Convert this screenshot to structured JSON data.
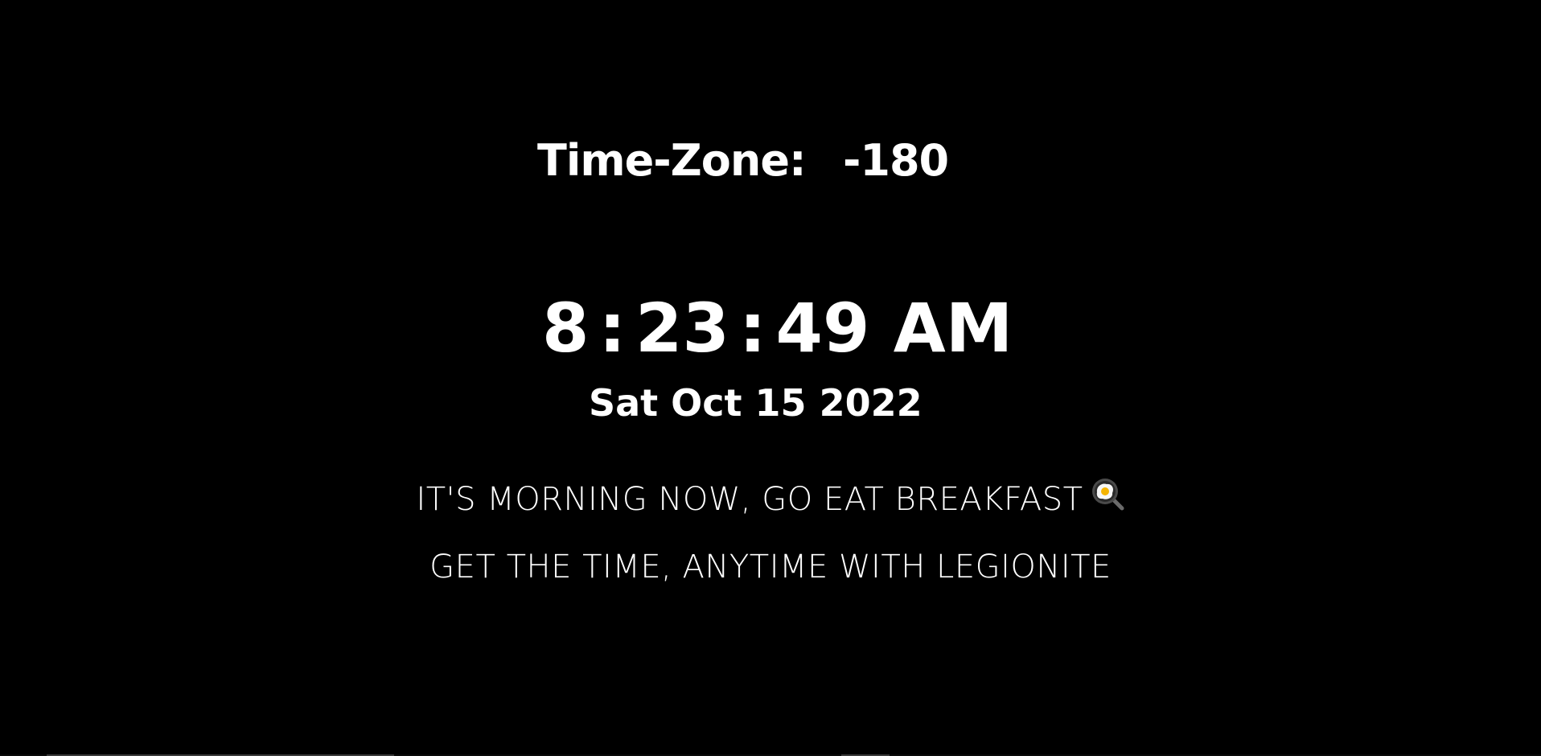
{
  "timezone": {
    "label": "Time-Zone:",
    "value": "-180"
  },
  "clock": {
    "hours": "8",
    "minutes": "23",
    "seconds": "49",
    "period": "AM",
    "separator": ":"
  },
  "date": "Sat Oct 15 2022",
  "greeting": {
    "text": "IT'S MORNING NOW, GO EAT BREAKFAST",
    "icon": "frying-pan-egg-icon"
  },
  "tagline": "GET THE TIME, ANYTIME WITH LEGIONITE",
  "colors": {
    "background": "#000000",
    "text": "#ffffff"
  }
}
